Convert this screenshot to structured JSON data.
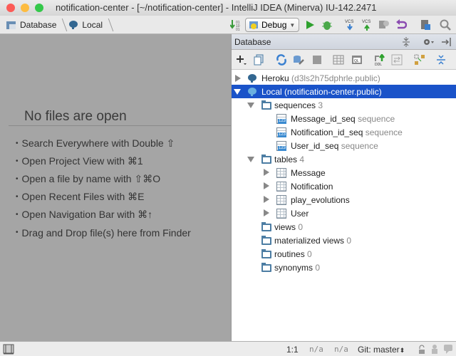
{
  "window": {
    "title": "notification-center - [~/notification-center] - IntelliJ IDEA (Minerva) IU-142.2471",
    "traffic_lights": {
      "close": "#fc5b57",
      "minimize": "#fdbc40",
      "zoom": "#34c84a"
    }
  },
  "navbar": {
    "breadcrumbs": [
      {
        "label": "Database",
        "icon": "database-folder-icon"
      },
      {
        "label": "Local",
        "icon": "postgresql-elephant-icon"
      }
    ],
    "run_config": "Debug",
    "toolbar_icons": [
      "make-project-icon",
      "run-config-icon",
      "run-icon",
      "debug-icon",
      "vcs-update-icon",
      "vcs-commit-icon",
      "vcs-history-icon",
      "revert-icon",
      "project-structure-icon",
      "search-icon"
    ]
  },
  "editor": {
    "empty_title": "No files are open",
    "hints": [
      "Search Everywhere with Double ⇧",
      "Open Project View with ⌘1",
      "Open a file by name with ⇧⌘O",
      "Open Recent Files with ⌘E",
      "Open Navigation Bar with ⌘↑",
      "Drag and Drop file(s) here from Finder"
    ]
  },
  "database_panel": {
    "title": "Database",
    "header_icons": [
      "collapse-split-icon",
      "gear-icon",
      "hide-panel-icon"
    ],
    "toolbar_icons": [
      "add-icon",
      "copy-icon",
      "refresh-icon",
      "data-source-properties-icon",
      "stop-icon",
      "table-editor-icon",
      "console-icon",
      "ddl-icon",
      "compare-icon",
      "diagram-icon",
      "collapse-all-icon"
    ],
    "tree": [
      {
        "label": "Heroku",
        "detail": "(d3ls2h75dphrle.public)",
        "type": "datasource",
        "expanded": false,
        "selected": false
      },
      {
        "label": "Local",
        "detail": "(notification-center.public)",
        "type": "datasource",
        "expanded": true,
        "selected": true
      },
      {
        "label": "sequences",
        "detail": "3",
        "type": "folder",
        "expanded": true
      },
      {
        "label": "Message_id_seq",
        "detail": "sequence",
        "type": "sequence"
      },
      {
        "label": "Notification_id_seq",
        "detail": "sequence",
        "type": "sequence"
      },
      {
        "label": "User_id_seq",
        "detail": "sequence",
        "type": "sequence"
      },
      {
        "label": "tables",
        "detail": "4",
        "type": "folder",
        "expanded": true
      },
      {
        "label": "Message",
        "detail": "",
        "type": "table",
        "expanded": false
      },
      {
        "label": "Notification",
        "detail": "",
        "type": "table",
        "expanded": false
      },
      {
        "label": "play_evolutions",
        "detail": "",
        "type": "table",
        "expanded": false
      },
      {
        "label": "User",
        "detail": "",
        "type": "table",
        "expanded": false
      },
      {
        "label": "views",
        "detail": "0",
        "type": "folder"
      },
      {
        "label": "materialized views",
        "detail": "0",
        "type": "folder"
      },
      {
        "label": "routines",
        "detail": "0",
        "type": "folder"
      },
      {
        "label": "synonyms",
        "detail": "0",
        "type": "folder"
      }
    ]
  },
  "statusbar": {
    "position": "1:1",
    "line_separator": "n/a",
    "encoding": "n/a",
    "vcs_branch": "Git: master"
  },
  "colors": {
    "selection": "#1a53c9",
    "editor_bg": "#a5a5a5"
  }
}
